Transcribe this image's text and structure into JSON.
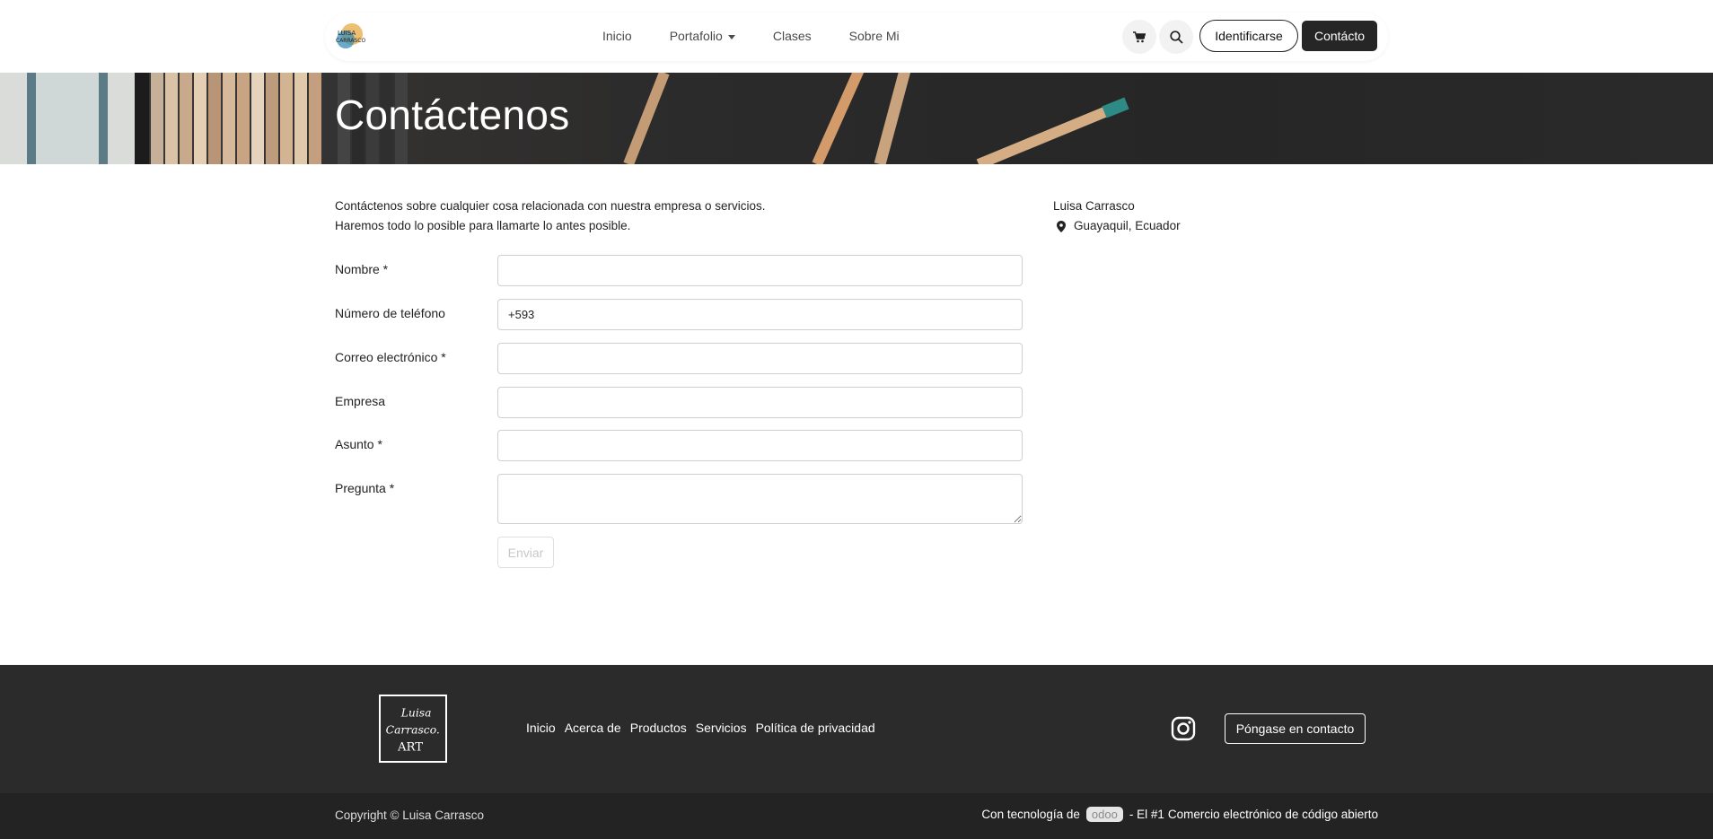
{
  "header": {
    "logo_icon": "luisa-carrasco-logo",
    "nav": [
      {
        "label": "Inicio"
      },
      {
        "label": "Portafolio"
      },
      {
        "label": "Clases"
      },
      {
        "label": "Sobre Mi"
      }
    ],
    "cart_icon": "cart-icon",
    "search_icon": "search-icon",
    "login_label": "Identificarse",
    "contact_label": "Contácto"
  },
  "hero": {
    "title": "Contáctenos"
  },
  "intro": {
    "line1": "Contáctenos sobre cualquier cosa relacionada con nuestra empresa o servicios.",
    "line2": "Haremos todo lo posible para llamarte lo antes posible."
  },
  "form": {
    "fields": [
      {
        "label": "Nombre *",
        "value": ""
      },
      {
        "label": "Número de teléfono",
        "value": "+593"
      },
      {
        "label": "Correo electrónico *",
        "value": ""
      },
      {
        "label": "Empresa",
        "value": ""
      },
      {
        "label": "Asunto *",
        "value": ""
      },
      {
        "label": "Pregunta *",
        "value": ""
      }
    ],
    "submit_label": "Enviar"
  },
  "contact_info": {
    "name": "Luisa Carrasco",
    "location": "Guayaquil, Ecuador"
  },
  "footer": {
    "logo_text": [
      "Luisa",
      "Carrasco.",
      "ART"
    ],
    "links": [
      "Inicio",
      "Acerca de",
      "Productos",
      "Servicios",
      "Política de privacidad"
    ],
    "social_icon": "instagram-icon",
    "cta_label": "Póngase en contacto",
    "copyright": "Copyright © Luisa Carrasco",
    "powered_prefix": "Con tecnología de",
    "powered_brand": "odoo",
    "powered_suffix": "- El #1",
    "powered_link": "Comercio electrónico de código abierto"
  },
  "colors": {
    "dark": "#262626",
    "footer": "#2b2b2b",
    "copyright_bar": "#232323"
  }
}
